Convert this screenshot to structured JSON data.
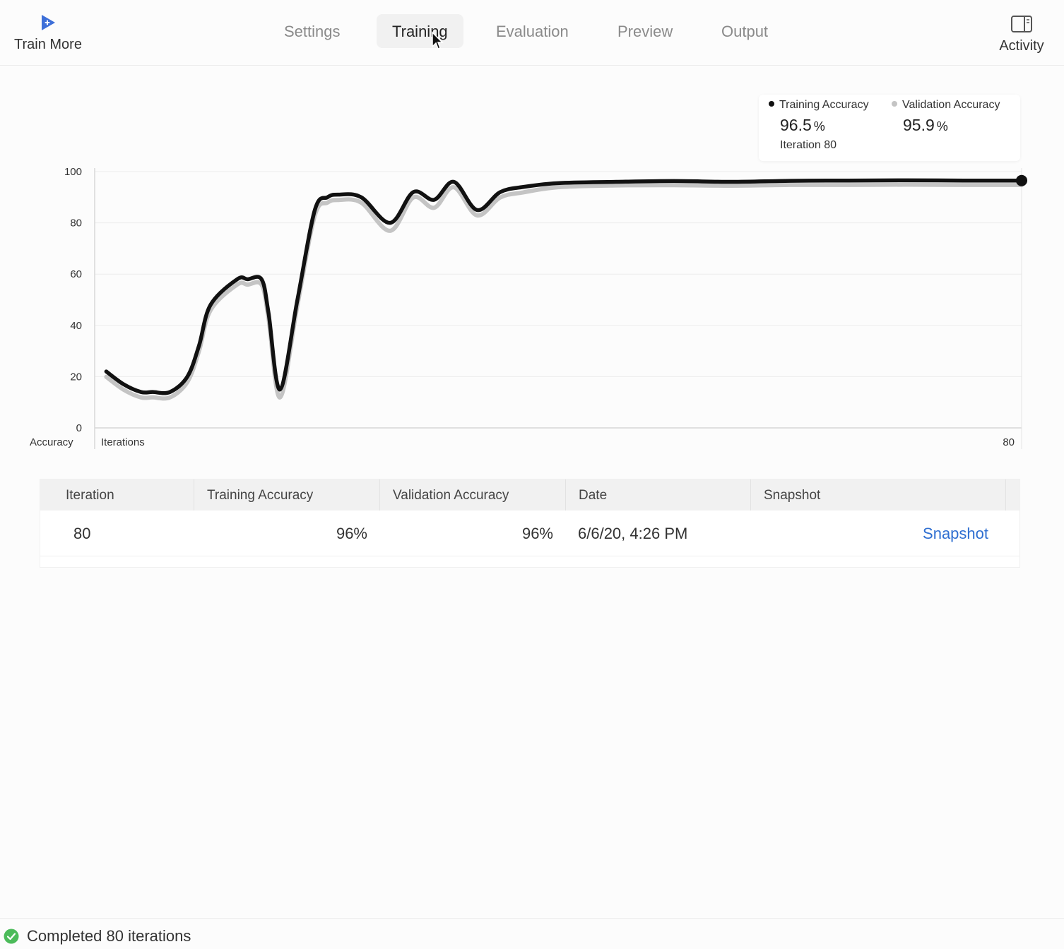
{
  "toolbar": {
    "train_more_label": "Train More",
    "tabs": [
      {
        "label": "Settings",
        "active": false
      },
      {
        "label": "Training",
        "active": true
      },
      {
        "label": "Evaluation",
        "active": false
      },
      {
        "label": "Preview",
        "active": false
      },
      {
        "label": "Output",
        "active": false
      }
    ],
    "activity_label": "Activity"
  },
  "colors": {
    "accent": "#3d6fd8",
    "link": "#2f6fd1",
    "training_series": "#111111",
    "validation_series": "#c4c4c4",
    "success": "#4cbb5a"
  },
  "icons": {
    "train_more": "play-icon",
    "activity": "sidebar-panel-icon",
    "status": "checkmark-circle-icon",
    "cursor": "mouse-pointer-icon"
  },
  "legend": {
    "training": {
      "name": "Training Accuracy",
      "value": "96.5",
      "unit": "%",
      "iteration": "Iteration 80"
    },
    "validation": {
      "name": "Validation Accuracy",
      "value": "95.9",
      "unit": "%"
    }
  },
  "chart_data": {
    "type": "line",
    "ylabel": "Accuracy",
    "xlabel": "Iterations",
    "ylim": [
      0,
      100
    ],
    "xlim": [
      0,
      80
    ],
    "y_ticks": [
      "100",
      "80",
      "60",
      "40",
      "20",
      "0"
    ],
    "x_tick_labels": [
      "80"
    ],
    "grid": true,
    "legend_position": "top-right",
    "series": [
      {
        "name": "Training Accuracy",
        "x": [
          1,
          2.5,
          4,
          5,
          6.5,
          8,
          9,
          10,
          12.3,
          13.2,
          14.4,
          15,
          16,
          17.5,
          19,
          20.1,
          21,
          23,
          25.5,
          27.5,
          29.3,
          31,
          33,
          35,
          37,
          40,
          45,
          50,
          55,
          60,
          65,
          70,
          75,
          80
        ],
        "y": [
          22,
          17,
          14,
          14,
          14,
          20,
          32,
          48,
          58,
          58,
          58,
          45,
          15,
          50,
          85,
          90,
          91,
          90,
          80,
          92,
          89,
          96,
          85,
          92,
          94,
          95.5,
          96,
          96.3,
          96,
          96.4,
          96.5,
          96.6,
          96.5,
          96.5
        ]
      },
      {
        "name": "Validation Accuracy",
        "x": [
          1,
          2.5,
          4,
          5,
          6.5,
          8,
          9,
          10,
          12.3,
          13.2,
          14.4,
          15,
          16,
          17.5,
          19,
          20.1,
          21,
          23,
          25.5,
          27.5,
          29.3,
          31,
          33,
          35,
          37,
          40,
          45,
          50,
          55,
          60,
          65,
          70,
          75,
          80
        ],
        "y": [
          21,
          16,
          13,
          13,
          13,
          19,
          31,
          47,
          57,
          57,
          57,
          44,
          13,
          49,
          84,
          89,
          90,
          89,
          78,
          91,
          87,
          95,
          84,
          91,
          93,
          95,
          95.7,
          95.8,
          95.6,
          95.9,
          95.9,
          96,
          95.9,
          95.9
        ]
      }
    ]
  },
  "table": {
    "headers": [
      "Iteration",
      "Training Accuracy",
      "Validation Accuracy",
      "Date",
      "Snapshot"
    ],
    "rows": [
      {
        "iteration": "80",
        "training_accuracy": "96%",
        "validation_accuracy": "96%",
        "date": "6/6/20, 4:26 PM",
        "snapshot": "Snapshot"
      }
    ]
  },
  "status": {
    "text": "Completed 80 iterations"
  }
}
